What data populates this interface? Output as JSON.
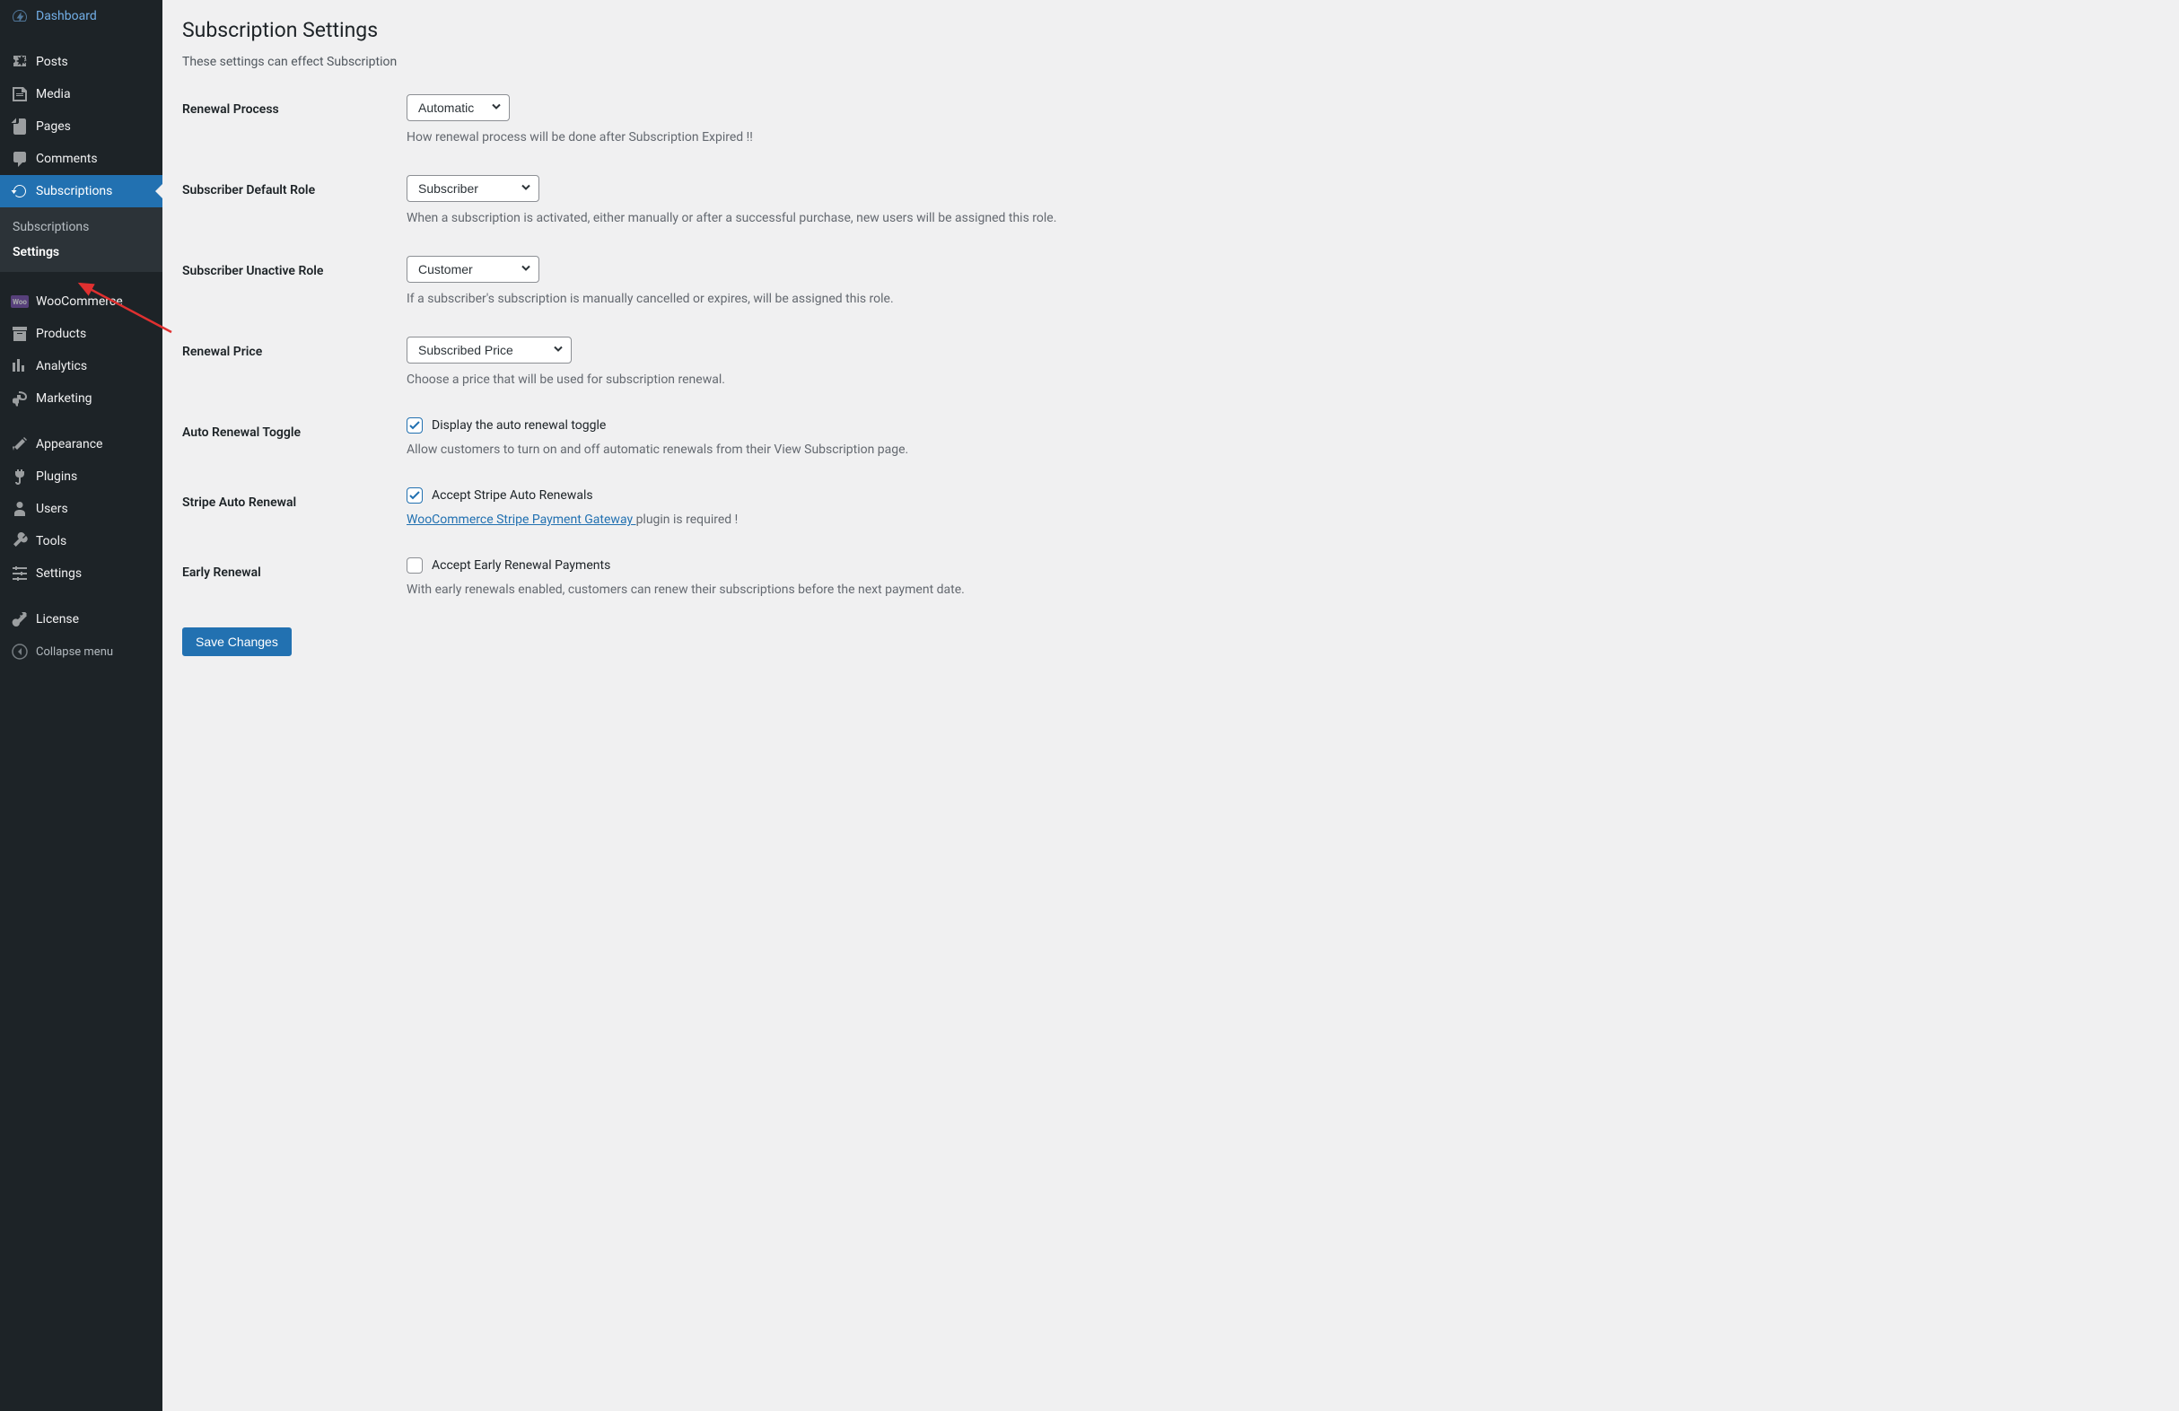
{
  "sidebar": {
    "items": [
      {
        "label": "Dashboard",
        "icon": "dashboard"
      },
      {
        "label": "Posts",
        "icon": "posts"
      },
      {
        "label": "Media",
        "icon": "media"
      },
      {
        "label": "Pages",
        "icon": "pages"
      },
      {
        "label": "Comments",
        "icon": "comments"
      },
      {
        "label": "Subscriptions",
        "icon": "subscriptions",
        "active": true
      },
      {
        "label": "WooCommerce",
        "icon": "woo"
      },
      {
        "label": "Products",
        "icon": "products"
      },
      {
        "label": "Analytics",
        "icon": "analytics"
      },
      {
        "label": "Marketing",
        "icon": "marketing"
      },
      {
        "label": "Appearance",
        "icon": "appearance"
      },
      {
        "label": "Plugins",
        "icon": "plugins"
      },
      {
        "label": "Users",
        "icon": "users"
      },
      {
        "label": "Tools",
        "icon": "tools"
      },
      {
        "label": "Settings",
        "icon": "settings"
      },
      {
        "label": "License",
        "icon": "license"
      }
    ],
    "submenu": {
      "items": [
        {
          "label": "Subscriptions"
        },
        {
          "label": "Settings",
          "active": true
        }
      ]
    },
    "collapse_label": "Collapse menu"
  },
  "page": {
    "title": "Subscription Settings",
    "subtitle": "These settings can effect Subscription"
  },
  "fields": {
    "renewal_process": {
      "label": "Renewal Process",
      "value": "Automatic",
      "description": "How renewal process will be done after Subscription Expired !!"
    },
    "default_role": {
      "label": "Subscriber Default Role",
      "value": "Subscriber",
      "description": "When a subscription is activated, either manually or after a successful purchase, new users will be assigned this role."
    },
    "unactive_role": {
      "label": "Subscriber Unactive Role",
      "value": "Customer",
      "description": "If a subscriber's subscription is manually cancelled or expires, will be assigned this role."
    },
    "renewal_price": {
      "label": "Renewal Price",
      "value": "Subscribed Price",
      "description": "Choose a price that will be used for subscription renewal."
    },
    "auto_renewal_toggle": {
      "label": "Auto Renewal Toggle",
      "checkbox_label": "Display the auto renewal toggle",
      "checked": true,
      "description": "Allow customers to turn on and off automatic renewals from their View Subscription page."
    },
    "stripe_auto_renewal": {
      "label": "Stripe Auto Renewal",
      "checkbox_label": "Accept Stripe Auto Renewals",
      "checked": true,
      "link_text": "WooCommerce Stripe Payment Gateway ",
      "description_end": "plugin is required !"
    },
    "early_renewal": {
      "label": "Early Renewal",
      "checkbox_label": "Accept Early Renewal Payments",
      "checked": false,
      "description": "With early renewals enabled, customers can renew their subscriptions before the next payment date."
    }
  },
  "submit_label": "Save Changes",
  "woo_badge_text": "Woo"
}
